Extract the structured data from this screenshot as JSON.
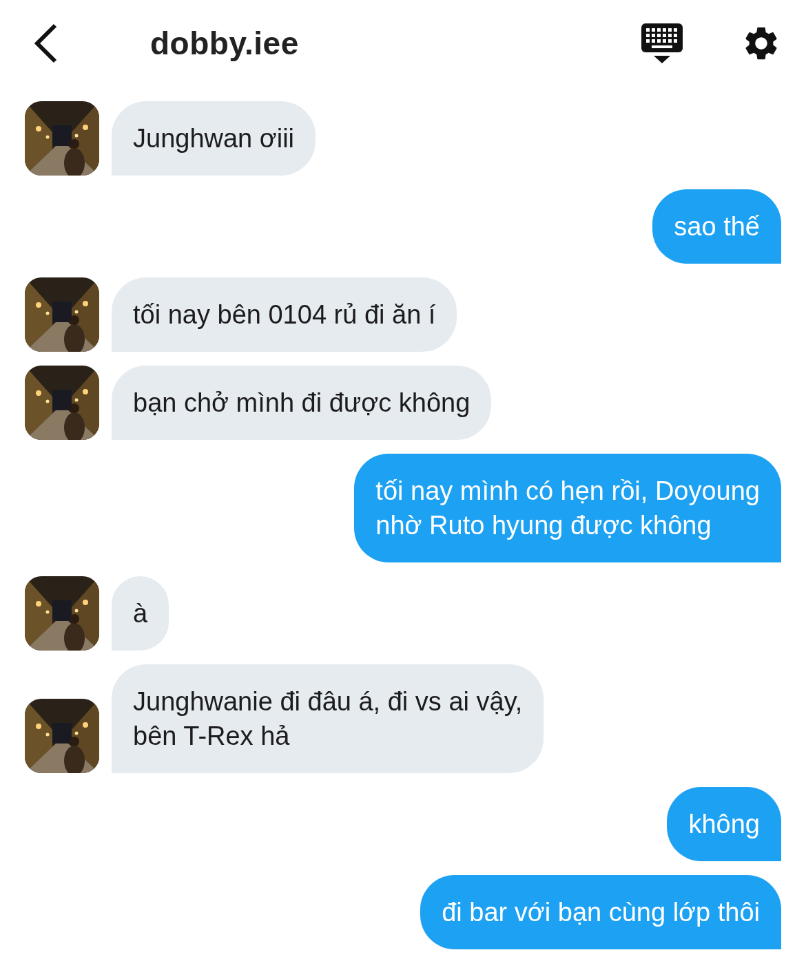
{
  "header": {
    "title": "dobby.iee"
  },
  "messages": [
    {
      "kind": "received",
      "text": "Junghwan ơiii"
    },
    {
      "kind": "sent",
      "text": "sao thế"
    },
    {
      "kind": "received",
      "text": "tối nay bên 0104 rủ đi ăn í"
    },
    {
      "kind": "received",
      "text": "bạn chở mình đi được không"
    },
    {
      "kind": "sent",
      "text": "tối nay mình có hẹn rồi, Doyoung\nnhờ Ruto hyung được không"
    },
    {
      "kind": "received",
      "text": "à"
    },
    {
      "kind": "received",
      "text": "Junghwanie đi đâu á, đi vs ai vậy,\nbên T-Rex hả"
    },
    {
      "kind": "sent",
      "text": "không"
    },
    {
      "kind": "sent",
      "text": "đi bar với bạn cùng lớp thôi"
    }
  ]
}
